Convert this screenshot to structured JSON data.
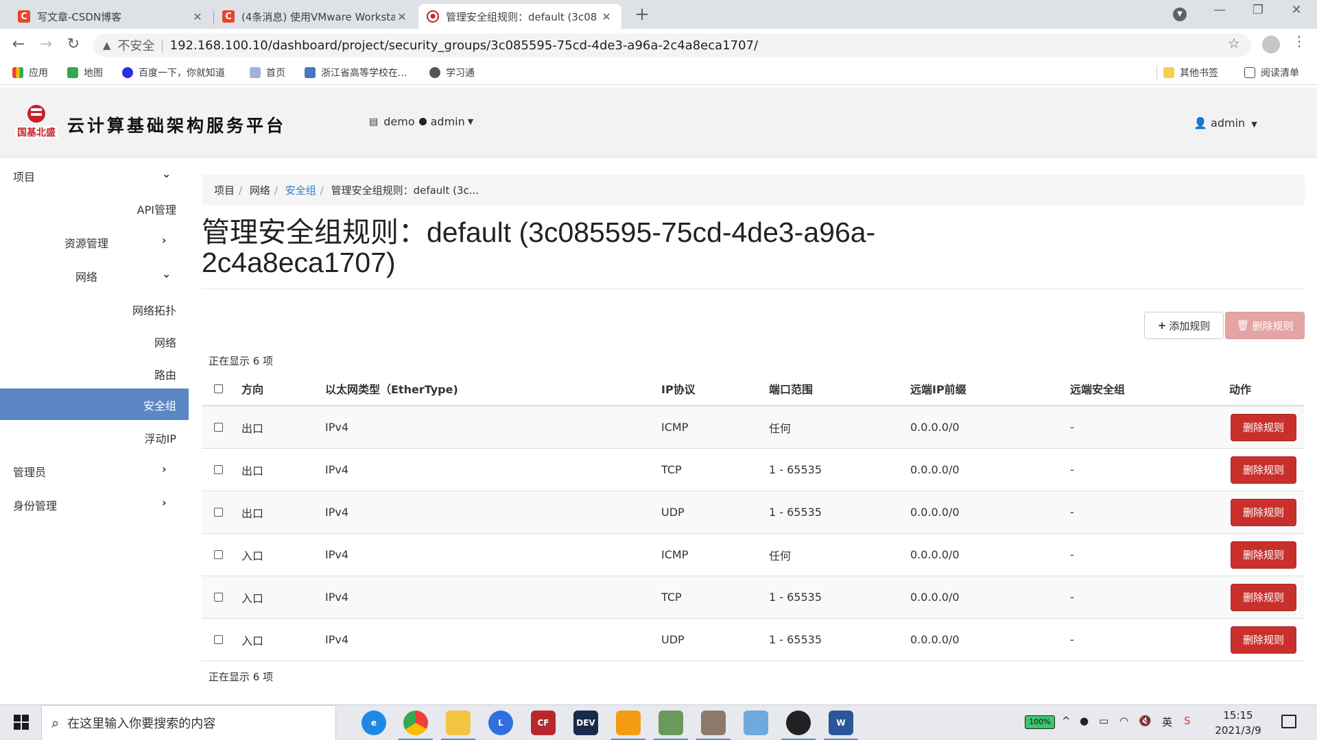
{
  "browser": {
    "tabs": [
      {
        "title": "写文章-CSDN博客",
        "favicon": "C"
      },
      {
        "title": "(4条消息) 使用VMware Worksta",
        "favicon": "C"
      },
      {
        "title": "管理安全组规则：default (3c08",
        "favicon": "os"
      }
    ],
    "address": {
      "insecure_label": "不安全",
      "url": "192.168.100.10/dashboard/project/security_groups/3c085595-75cd-4de3-a96a-2c4a8eca1707/"
    },
    "bookmarks": [
      "应用",
      "地图",
      "百度一下，你就知道",
      "首页",
      "浙江省高等学校在...",
      "学习通"
    ],
    "bookmarks_right": [
      "其他书签",
      "阅读清单"
    ]
  },
  "header": {
    "logo_brand": "国基北盛",
    "logo_text": "云计算基础架构服务平台",
    "project": "demo",
    "domain": "admin",
    "user": "admin"
  },
  "sidebar": {
    "items": [
      {
        "label": "项目",
        "chevron": "⌄"
      },
      {
        "label": "API管理",
        "chevron": ""
      },
      {
        "label": "资源管理",
        "chevron": "›"
      },
      {
        "label": "网络",
        "chevron": "⌄"
      },
      {
        "label": "网络拓扑",
        "chevron": ""
      },
      {
        "label": "网络",
        "chevron": ""
      },
      {
        "label": "路由",
        "chevron": ""
      },
      {
        "label": "安全组",
        "chevron": ""
      },
      {
        "label": "浮动IP",
        "chevron": ""
      },
      {
        "label": "管理员",
        "chevron": "›"
      },
      {
        "label": "身份管理",
        "chevron": "›"
      }
    ]
  },
  "breadcrumb": [
    "项目",
    "网络",
    "安全组",
    "管理安全组规则：default (3c..."
  ],
  "page_title": "管理安全组规则：default (3c085595-75cd-4de3-a96a-2c4a8eca1707)",
  "actions": {
    "add_rule": "添加规则",
    "delete_rules": "删除规则"
  },
  "count_text": "正在显示 6 项",
  "table": {
    "columns": [
      "方向",
      "以太网类型（EtherType)",
      "IP协议",
      "端口范围",
      "远端IP前缀",
      "远端安全组",
      "动作"
    ],
    "rows": [
      {
        "direction": "出口",
        "ethertype": "IPv4",
        "protocol": "ICMP",
        "port_range": "任何",
        "remote_ip": "0.0.0.0/0",
        "remote_group": "-",
        "action": "删除规则"
      },
      {
        "direction": "出口",
        "ethertype": "IPv4",
        "protocol": "TCP",
        "port_range": "1 - 65535",
        "remote_ip": "0.0.0.0/0",
        "remote_group": "-",
        "action": "删除规则"
      },
      {
        "direction": "出口",
        "ethertype": "IPv4",
        "protocol": "UDP",
        "port_range": "1 - 65535",
        "remote_ip": "0.0.0.0/0",
        "remote_group": "-",
        "action": "删除规则"
      },
      {
        "direction": "入口",
        "ethertype": "IPv4",
        "protocol": "ICMP",
        "port_range": "任何",
        "remote_ip": "0.0.0.0/0",
        "remote_group": "-",
        "action": "删除规则"
      },
      {
        "direction": "入口",
        "ethertype": "IPv4",
        "protocol": "TCP",
        "port_range": "1 - 65535",
        "remote_ip": "0.0.0.0/0",
        "remote_group": "-",
        "action": "删除规则"
      },
      {
        "direction": "入口",
        "ethertype": "IPv4",
        "protocol": "UDP",
        "port_range": "1 - 65535",
        "remote_ip": "0.0.0.0/0",
        "remote_group": "-",
        "action": "删除规则"
      }
    ]
  },
  "taskbar": {
    "search_placeholder": "在这里输入你要搜索的内容",
    "battery": "100%",
    "ime": "英",
    "time": "15:15",
    "date": "2021/3/9"
  },
  "colors": {
    "accent": "#5b87c7",
    "danger": "#c9302c",
    "link": "#3479c5"
  }
}
